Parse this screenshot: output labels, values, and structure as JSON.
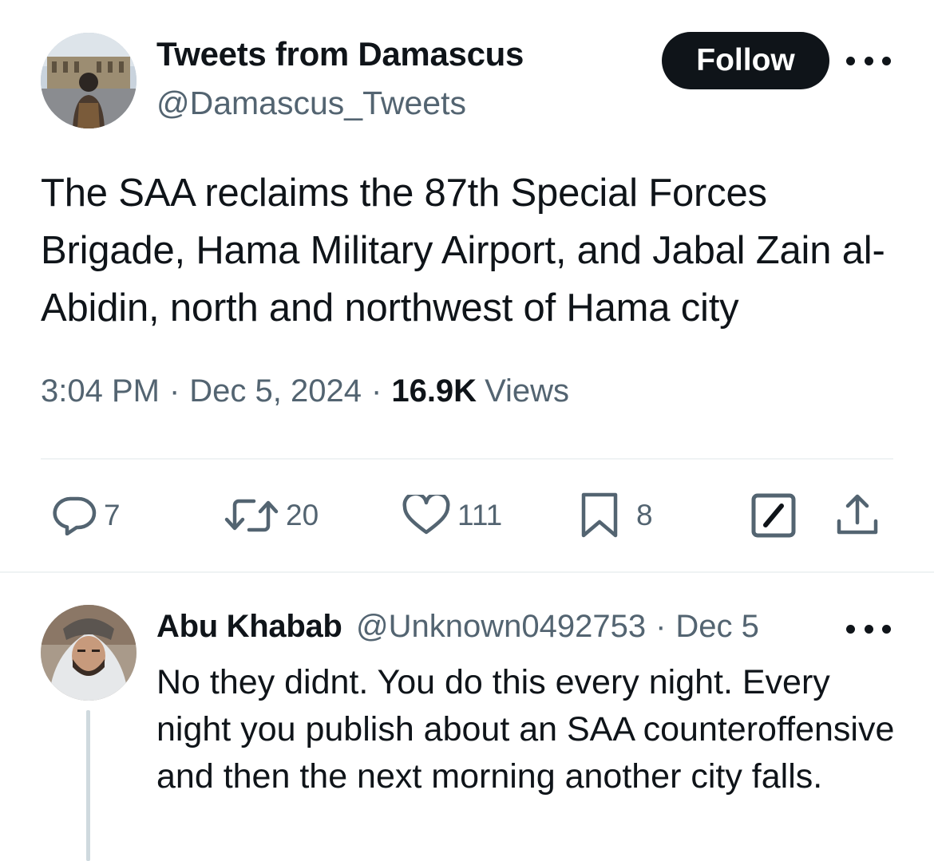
{
  "tweet": {
    "author": {
      "name": "Tweets from Damascus",
      "handle": "@Damascus_Tweets"
    },
    "follow_label": "Follow",
    "text": "The SAA reclaims the 87th Special Forces Brigade, Hama Military Airport, and Jabal Zain al-Abidin, north and northwest of Hama city",
    "time": "3:04 PM",
    "date": "Dec 5, 2024",
    "sep": "·",
    "views_count": "16.9K",
    "views_label": "Views",
    "actions": {
      "replies": "7",
      "retweets": "20",
      "likes": "111",
      "bookmarks": "8"
    },
    "icons": {
      "reply": "reply-icon",
      "retweet": "retweet-icon",
      "like": "heart-icon",
      "bookmark": "bookmark-icon",
      "grok": "grok-icon",
      "share": "share-icon",
      "more": "more-icon"
    }
  },
  "reply": {
    "author": {
      "name": "Abu Khabab",
      "handle": "@Unknown0492753"
    },
    "sep": "·",
    "date": "Dec 5",
    "text": "No they didnt. You do this every night. Every night you publish about an SAA counteroffensive and then the next morning another city falls."
  },
  "colors": {
    "text": "#0f1419",
    "secondary": "#536471",
    "divider": "#eff3f4",
    "follow_bg": "#0f1419",
    "thread_line": "#cfd9de"
  }
}
